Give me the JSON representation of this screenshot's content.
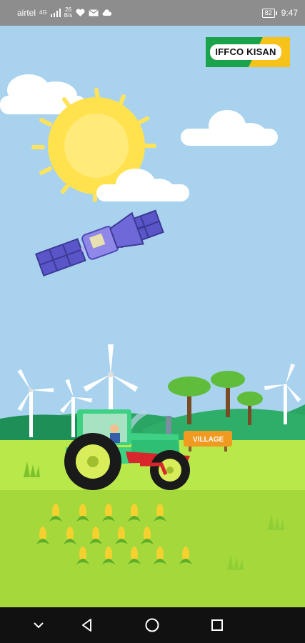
{
  "status_bar": {
    "carrier": "airtel",
    "network_type": "4G",
    "data_speed_value": "26",
    "data_speed_unit": "B/s",
    "battery": "82",
    "time": "9:47"
  },
  "logo": {
    "text": "IFFCO KISAN"
  },
  "scene": {
    "village_sign": "VILLAGE"
  },
  "colors": {
    "sky": "#a9d2ee",
    "sun": "#ffe24d",
    "tractor_body": "#3ed184",
    "tractor_frame": "#d8262c",
    "field_front": "#a4d83b",
    "field_back": "#b9e84a",
    "hill": "#1e8f56",
    "sign": "#f09a22",
    "logo_green": "#1aa34a",
    "logo_yellow": "#f7c21a"
  },
  "nav_bar": {
    "icons": [
      "chevron-down-icon",
      "back-icon",
      "home-icon",
      "recents-icon"
    ]
  }
}
